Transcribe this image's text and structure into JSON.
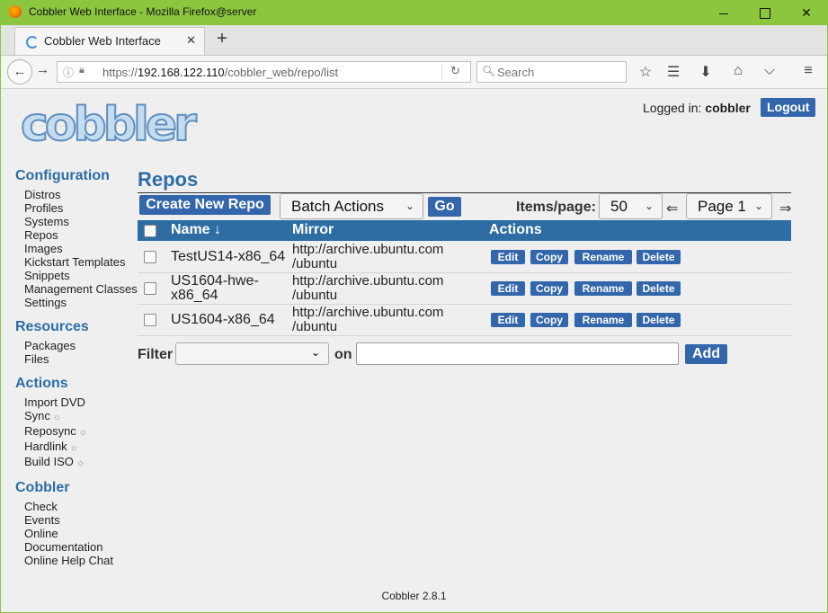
{
  "window": {
    "title": "Cobbler Web Interface - Mozilla Firefox@server",
    "min": "—",
    "max": "",
    "close": "✕"
  },
  "tab": {
    "title": "Cobbler Web Interface",
    "close": "✕",
    "new": "+"
  },
  "nav": {
    "url_prefix": "https://",
    "url_host": "192.168.122.110",
    "url_path": "/cobbler_web/repo/list",
    "search_placeholder": "Search",
    "icons": [
      "back-icon",
      "forward-icon",
      "info-icon",
      "lock-icon",
      "reload-icon",
      "search-icon",
      "star-icon",
      "reader-icon",
      "download-icon",
      "home-icon",
      "pocket-icon",
      "menu-icon"
    ]
  },
  "header": {
    "logo": "cobbler",
    "logged_in_label": "Logged in:",
    "user": "cobbler",
    "logout": "Logout"
  },
  "sidebar": {
    "configuration": {
      "title": "Configuration",
      "items": [
        "Distros",
        "Profiles",
        "Systems",
        "Repos",
        "Images",
        "Kickstart Templates",
        "Snippets",
        "Management Classes",
        "Settings"
      ]
    },
    "resources": {
      "title": "Resources",
      "items": [
        "Packages",
        "Files"
      ]
    },
    "actions": {
      "title": "Actions",
      "items": [
        "Import DVD",
        "Sync",
        "Reposync",
        "Hardlink",
        "Build ISO"
      ],
      "sun": "☼"
    },
    "cobbler": {
      "title": "Cobbler",
      "items": [
        "Check",
        "Events",
        "Online",
        "Documentation",
        "Online Help Chat"
      ]
    }
  },
  "main": {
    "title": "Repos",
    "create_button": "Create New Repo",
    "batch_actions": "Batch Actions",
    "go_button": "Go",
    "items_per_page_label": "Items/page:",
    "items_per_page": "50",
    "prev_arrow": "⇐",
    "page": "Page 1",
    "next_arrow": "⇒",
    "columns": [
      "Name ↓",
      "Mirror",
      "Actions"
    ],
    "rows": [
      {
        "name": [
          "TestUS14-x86_64"
        ],
        "mirror": [
          "http://archive.ubuntu.com",
          "/ubuntu"
        ]
      },
      {
        "name": [
          "US1604-hwe-",
          "x86_64"
        ],
        "mirror": [
          "http://archive.ubuntu.com",
          "/ubuntu"
        ]
      },
      {
        "name": [
          "US1604-x86_64"
        ],
        "mirror": [
          "http://archive.ubuntu.com",
          "/ubuntu"
        ]
      }
    ],
    "actions": [
      "Edit",
      "Copy",
      "Rename",
      "Delete"
    ],
    "filter_label": "Filter",
    "on_label": "on",
    "add_button": "Add"
  },
  "footer": "Cobbler 2.8.1",
  "colors": {
    "accent": "#2e6da4",
    "button": "#3366aa",
    "window_frame": "#8cc63f"
  }
}
